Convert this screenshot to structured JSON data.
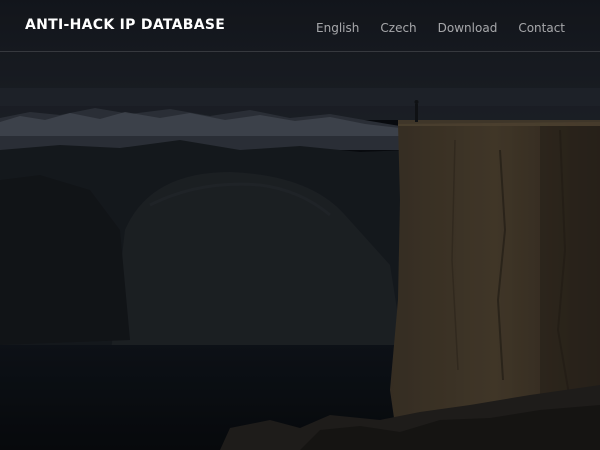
{
  "brand": {
    "title": "ANTI-HACK IP DATABASE"
  },
  "nav": {
    "items": [
      {
        "label": "English"
      },
      {
        "label": "Czech"
      },
      {
        "label": "Download"
      },
      {
        "label": "Contact"
      }
    ]
  },
  "colors": {
    "brand_text": "#ffffff",
    "nav_text": "#a8aaae",
    "background": "#0c0f14"
  }
}
